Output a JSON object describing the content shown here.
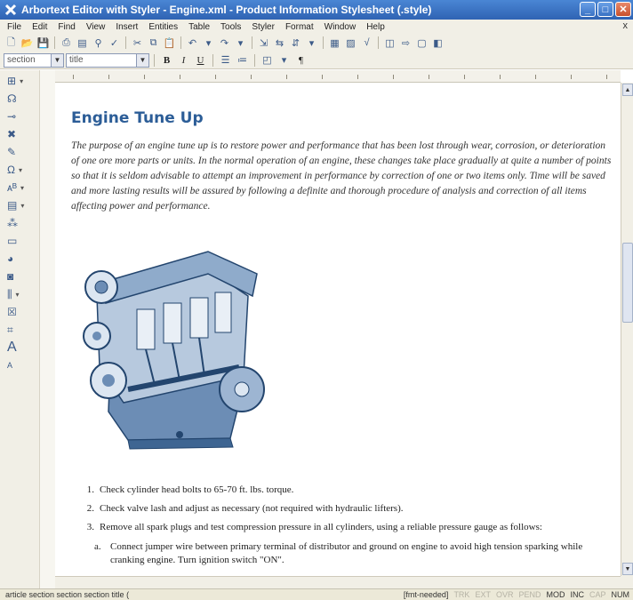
{
  "window": {
    "title": "Arbortext Editor with Styler - Engine.xml - Product Information Stylesheet (.style)"
  },
  "menu": {
    "items": [
      "File",
      "Edit",
      "Find",
      "View",
      "Insert",
      "Entities",
      "Table",
      "Tools",
      "Styler",
      "Format",
      "Window",
      "Help"
    ],
    "close": "x"
  },
  "toolbar": {
    "element_select": "section",
    "style_select": "title",
    "bold": "B",
    "italic": "I",
    "underline": "U",
    "pilcrow": "¶"
  },
  "document": {
    "heading": "Engine Tune Up",
    "intro": "The purpose of an engine tune up is to restore power and performance that has been lost through wear, corrosion, or deterioration of one ore more parts or units. In the normal operation of an engine, these changes take place gradually at quite a number of points so that it is seldom advisable to attempt an improvement in performance by correction of one or two items only. Time will be saved and more lasting results will be assured by following a definite and thorough procedure of analysis and correction of all items affecting power and performance.",
    "steps": [
      {
        "num": "1.",
        "text": "Check cylinder head bolts to 65-70 ft. lbs. torque."
      },
      {
        "num": "2.",
        "text": "Check valve lash and adjust as necessary (not required with hydraulic lifters)."
      },
      {
        "num": "3.",
        "text": "Remove all spark plugs and test compression pressure in all cylinders, using a reliable pressure gauge as follows:"
      }
    ],
    "substep": {
      "num": "a.",
      "text": "Connect jumper wire between primary terminal of distributor and ground on engine to avoid high tension sparking while cranking engine. Turn ignition switch \"ON\"."
    }
  },
  "status": {
    "path": "article section section section title (",
    "fmt": "[fmt-needed]",
    "indicators": [
      "TRK",
      "EXT",
      "OVR",
      "PEND",
      "MOD",
      "INC",
      "CAP",
      "NUM"
    ]
  },
  "colors": {
    "titlebar": "#2f63b3",
    "heading": "#2c5d97",
    "chrome": "#f1efe6"
  }
}
